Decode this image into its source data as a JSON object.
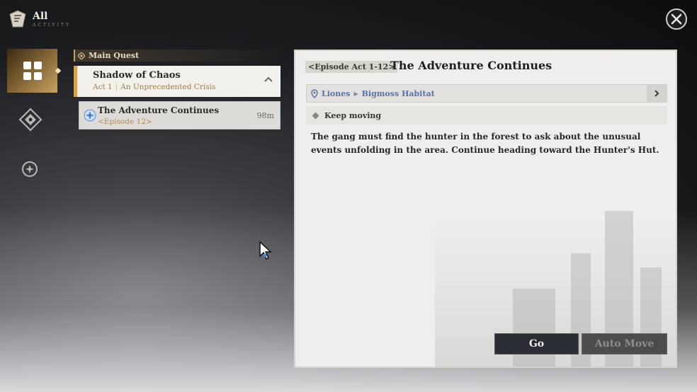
{
  "header": {
    "title": "All",
    "subtitle": "ACTIVITY"
  },
  "sidebar": {
    "tabs": [
      "all-quests",
      "world-quests",
      "side-quests"
    ]
  },
  "quest_list": {
    "category": "Main Quest",
    "chapter": {
      "title": "Shadow of Chaos",
      "act": "Act 1",
      "act_name": "An Unprecedented Crisis"
    },
    "episode": {
      "title": "The Adventure Continues",
      "tag": "<Episode 12>",
      "distance": "98m"
    }
  },
  "detail": {
    "episode_tag": "<Episode Act 1-12>",
    "title": "The Adventure Continues",
    "location": {
      "region": "Liones",
      "area": "Bigmoss Habitat"
    },
    "objective": "Keep moving",
    "description": "The gang must find the hunter in the forest to ask about the unusual events unfolding in the area. Continue heading toward the Hunter's Hut.",
    "buttons": {
      "go": "Go",
      "auto_move": "Auto Move"
    }
  },
  "colors": {
    "accent": "#d9a347",
    "location": "#5a72a8",
    "episode_tag": "#b08a52"
  }
}
